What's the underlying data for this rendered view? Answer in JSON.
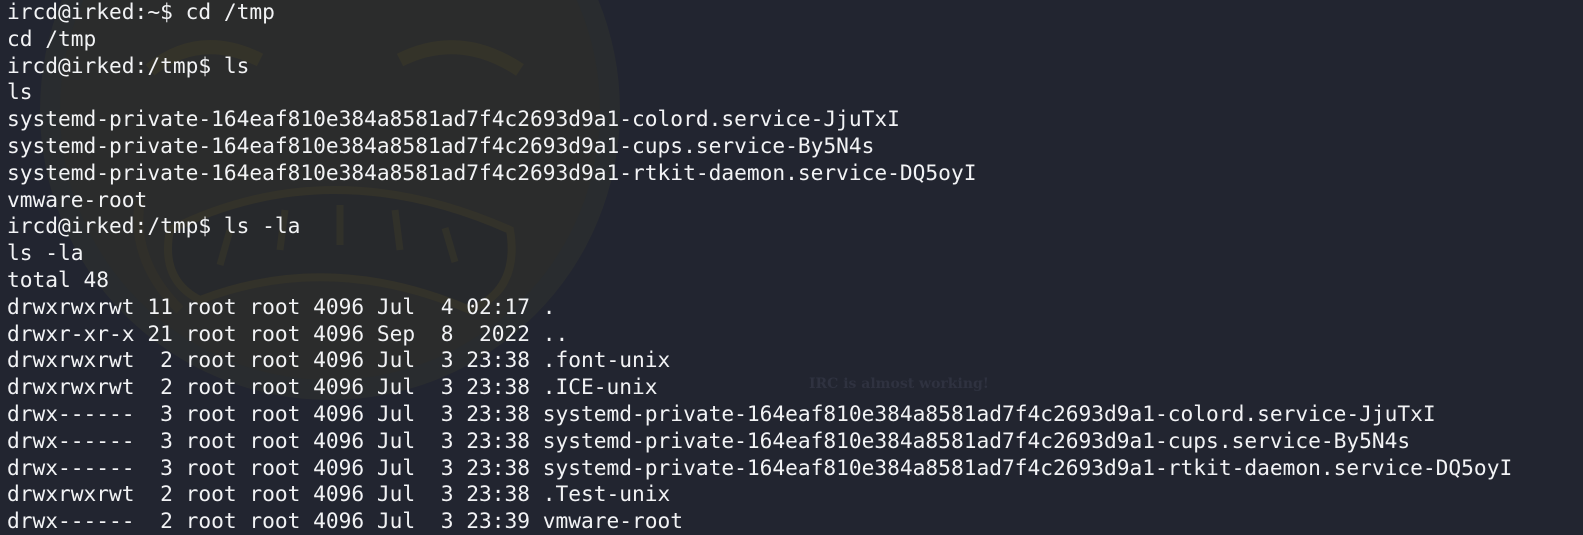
{
  "terminal": {
    "background_color": "#222530",
    "text_color": "#f2f3f5",
    "watermark_text": "IRC is almost working!",
    "background_art": "angry-face-icon",
    "lines": [
      "ircd@irked:~$ cd /tmp",
      "cd /tmp",
      "ircd@irked:/tmp$ ls",
      "ls",
      "systemd-private-164eaf810e384a8581ad7f4c2693d9a1-colord.service-JjuTxI",
      "systemd-private-164eaf810e384a8581ad7f4c2693d9a1-cups.service-By5N4s",
      "systemd-private-164eaf810e384a8581ad7f4c2693d9a1-rtkit-daemon.service-DQ5oyI",
      "vmware-root",
      "ircd@irked:/tmp$ ls -la",
      "ls -la",
      "total 48",
      "drwxrwxrwt 11 root root 4096 Jul  4 02:17 .",
      "drwxr-xr-x 21 root root 4096 Sep  8  2022 ..",
      "drwxrwxrwt  2 root root 4096 Jul  3 23:38 .font-unix",
      "drwxrwxrwt  2 root root 4096 Jul  3 23:38 .ICE-unix",
      "drwx------  3 root root 4096 Jul  3 23:38 systemd-private-164eaf810e384a8581ad7f4c2693d9a1-colord.service-JjuTxI",
      "drwx------  3 root root 4096 Jul  3 23:38 systemd-private-164eaf810e384a8581ad7f4c2693d9a1-cups.service-By5N4s",
      "drwx------  3 root root 4096 Jul  3 23:38 systemd-private-164eaf810e384a8581ad7f4c2693d9a1-rtkit-daemon.service-DQ5oyI",
      "drwxrwxrwt  2 root root 4096 Jul  3 23:38 .Test-unix",
      "drwx------  2 root root 4096 Jul  3 23:39 vmware-root"
    ]
  }
}
